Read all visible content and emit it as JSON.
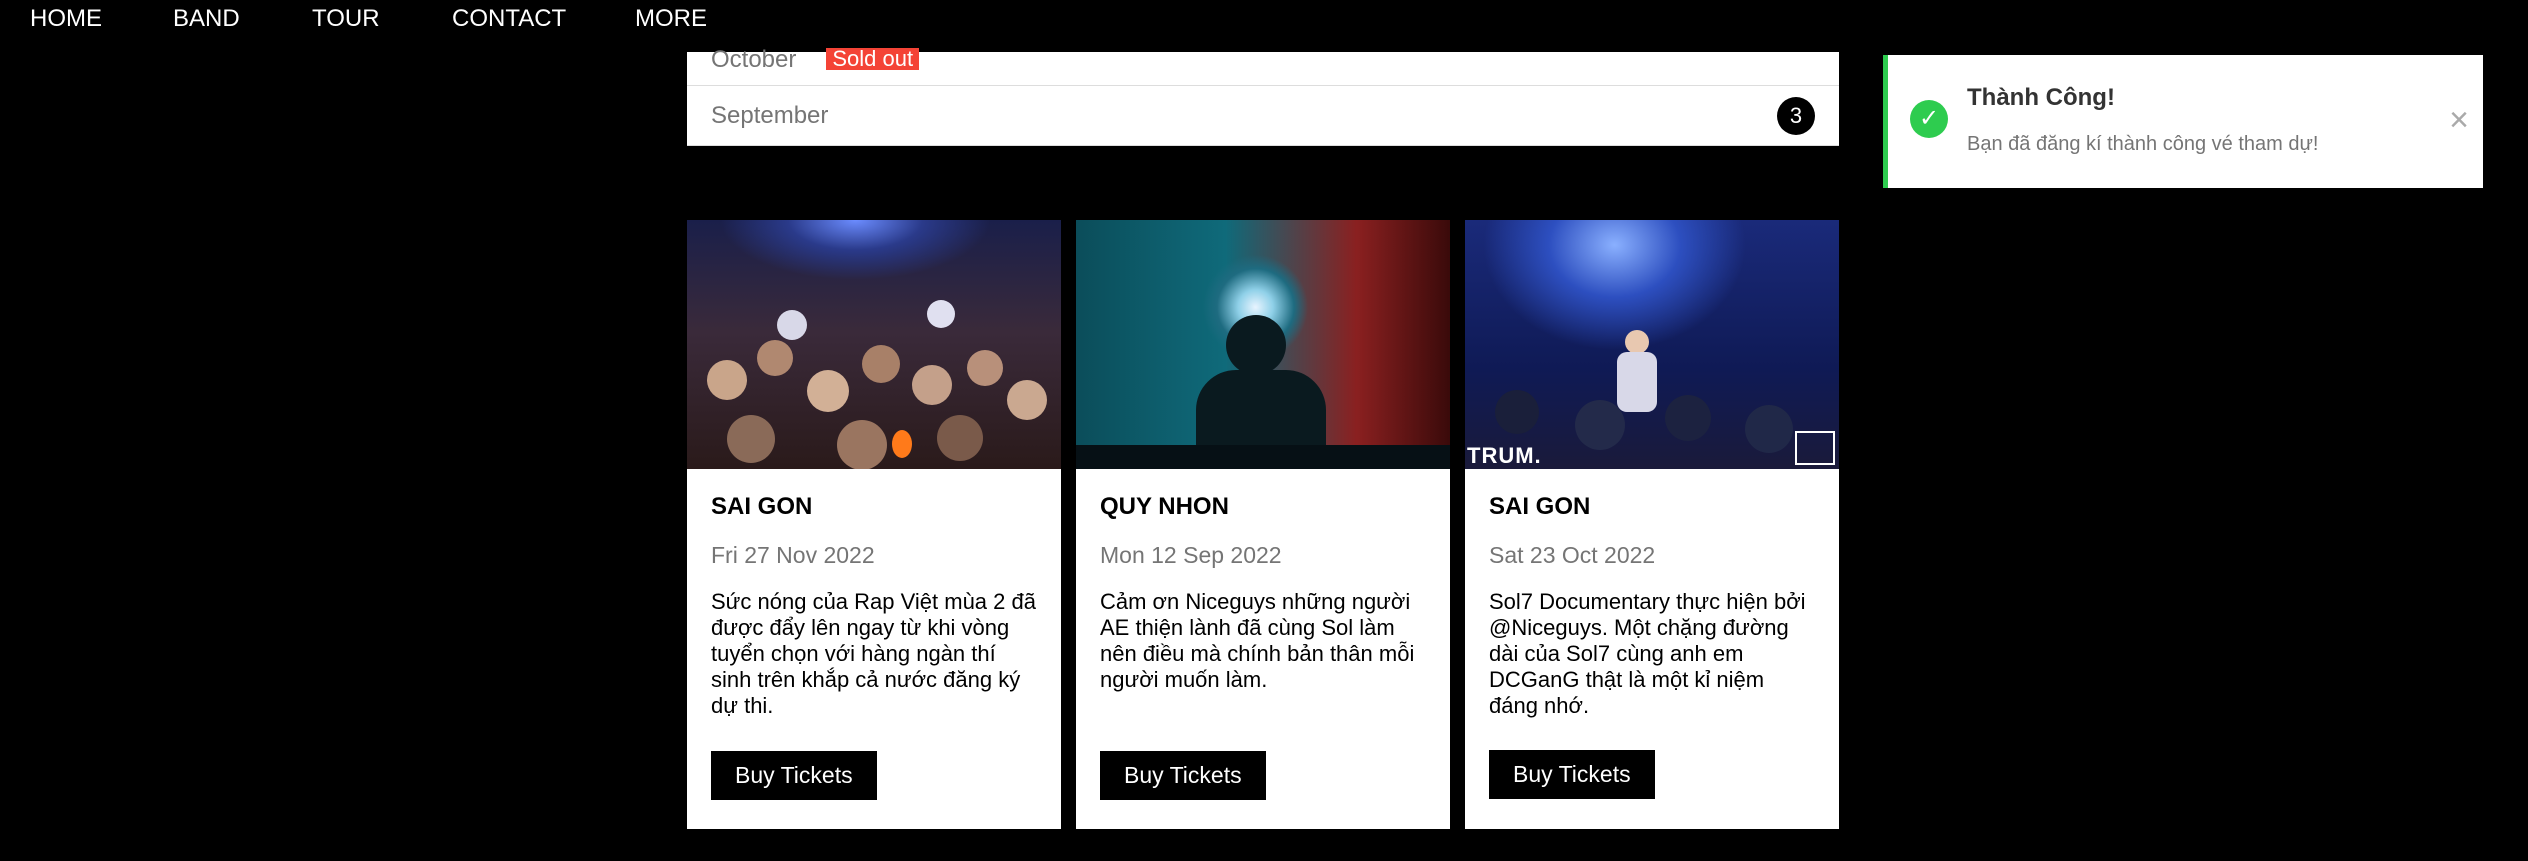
{
  "nav": {
    "items": [
      {
        "label": "HOME"
      },
      {
        "label": "BAND"
      },
      {
        "label": "TOUR"
      },
      {
        "label": "CONTACT"
      },
      {
        "label": "MORE"
      }
    ]
  },
  "months": [
    {
      "label": "October",
      "badge": "Sold out"
    },
    {
      "label": "September",
      "count": "3"
    }
  ],
  "cards": [
    {
      "city": "SAI GON",
      "date": "Fri 27 Nov 2022",
      "desc": "Sức nóng của Rap Việt mùa 2 đã được đẩy lên ngay từ khi vòng tuyển chọn với hàng ngàn thí sinh trên khắp cả nước đăng ký dự thi.",
      "button": "Buy Tickets"
    },
    {
      "city": "QUY NHON",
      "date": "Mon 12 Sep 2022",
      "desc": "Cảm ơn Niceguys những người AE thiện lành đã cùng Sol làm nên điều mà chính bản thân mỗi người muốn làm.",
      "button": "Buy Tickets"
    },
    {
      "city": "SAI GON",
      "date": "Sat 23 Oct 2022",
      "desc": "Sol7 Documentary thực hiện bởi @Niceguys. Một chặng đường dài của Sol7 cùng anh em DCGanG thật là một kỉ niệm đáng nhớ.",
      "button": "Buy Tickets",
      "watermark": "TRUM."
    }
  ],
  "toast": {
    "title": "Thành Công!",
    "message": "Bạn đã đăng kí thành công vé tham dự!",
    "icon": "check-circle-icon",
    "close_glyph": "×",
    "accent": "#2ecc4f"
  },
  "colors": {
    "sold_out": "#f44336",
    "page_bg": "#000000"
  }
}
